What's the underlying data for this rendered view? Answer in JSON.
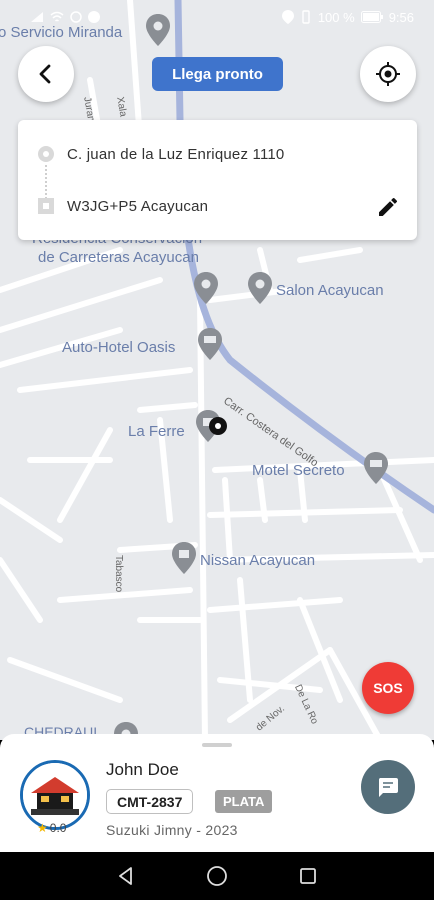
{
  "status_bar": {
    "battery": "100 %",
    "time": "9:56"
  },
  "top": {
    "eta_label": "Llega pronto"
  },
  "route": {
    "origin": "C. juan de la Luz Enriquez 1110",
    "destination": "W3JG+P5 Acayucan"
  },
  "map": {
    "places": {
      "servicio": "o Servicio Miranda",
      "residencia": "Residencia Conservación",
      "carreteras": "de Carreteras Acayucan",
      "salon": "Salon Acayucan",
      "autohotel": "Auto-Hotel Oasis",
      "laferre": "La Ferre",
      "motel": "Motel Secreto",
      "nissan": "Nissan Acayucan",
      "chedraui": "CHEDRAUI"
    },
    "streets": {
      "carr_costera": "Carr. Costera del Golfo",
      "tabasco": "Tabasco",
      "de_nov": "de Nov.",
      "de_la_ro": "De La Ro",
      "jurang": "Jurang",
      "xala": "Xala"
    }
  },
  "sos_label": "SOS",
  "driver": {
    "name": "John Doe",
    "plate": "CMT-2837",
    "tier": "PLATA",
    "vehicle": "Suzuki Jimny - 2023",
    "rating": "0.0"
  },
  "colors": {
    "accent": "#3f74cc",
    "sos": "#ef3b36",
    "chat": "#546e7a",
    "highway": "#a6b4dc"
  }
}
